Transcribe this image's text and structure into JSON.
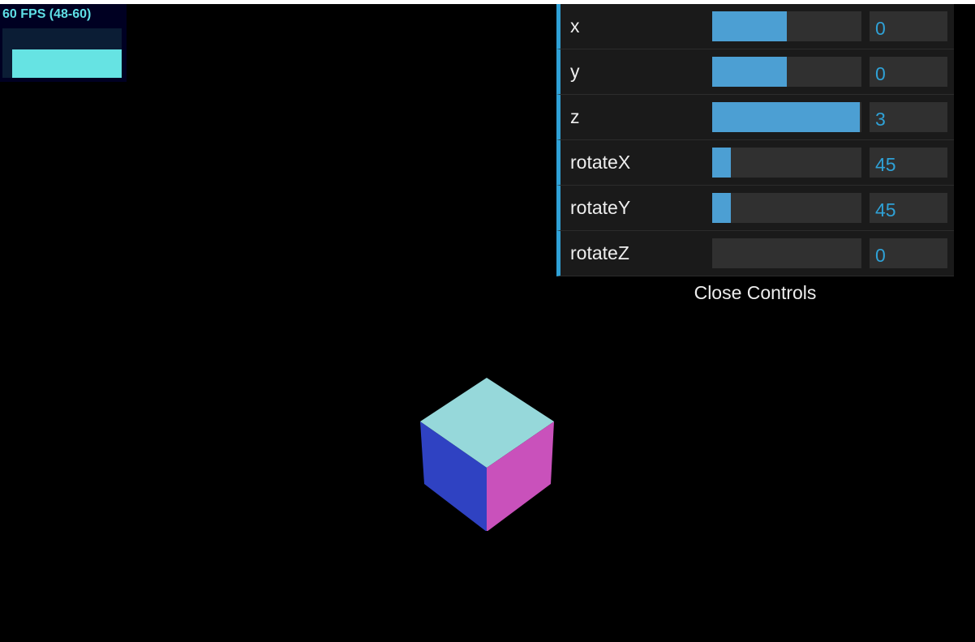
{
  "stats": {
    "fps_label": "60 FPS (48-60)",
    "graph_fill_ratio": 0.58,
    "colors": {
      "text": "#5fe0e6",
      "graph": "#66e3e3",
      "background": "#000022"
    }
  },
  "controls": {
    "rows": [
      {
        "label": "x",
        "value": "0",
        "fill": 0.5
      },
      {
        "label": "y",
        "value": "0",
        "fill": 0.5
      },
      {
        "label": "z",
        "value": "3",
        "fill": 0.99
      },
      {
        "label": "rotateX",
        "value": "45",
        "fill": 0.125
      },
      {
        "label": "rotateY",
        "value": "45",
        "fill": 0.125
      },
      {
        "label": "rotateZ",
        "value": "0",
        "fill": 0
      }
    ],
    "close_label": "Close Controls",
    "accent_color": "#2fa1d6"
  },
  "scene": {
    "background": "#000000",
    "cube_colors": {
      "top": "#96d8da",
      "left": "#2f42c2",
      "right": "#c951bb"
    }
  }
}
